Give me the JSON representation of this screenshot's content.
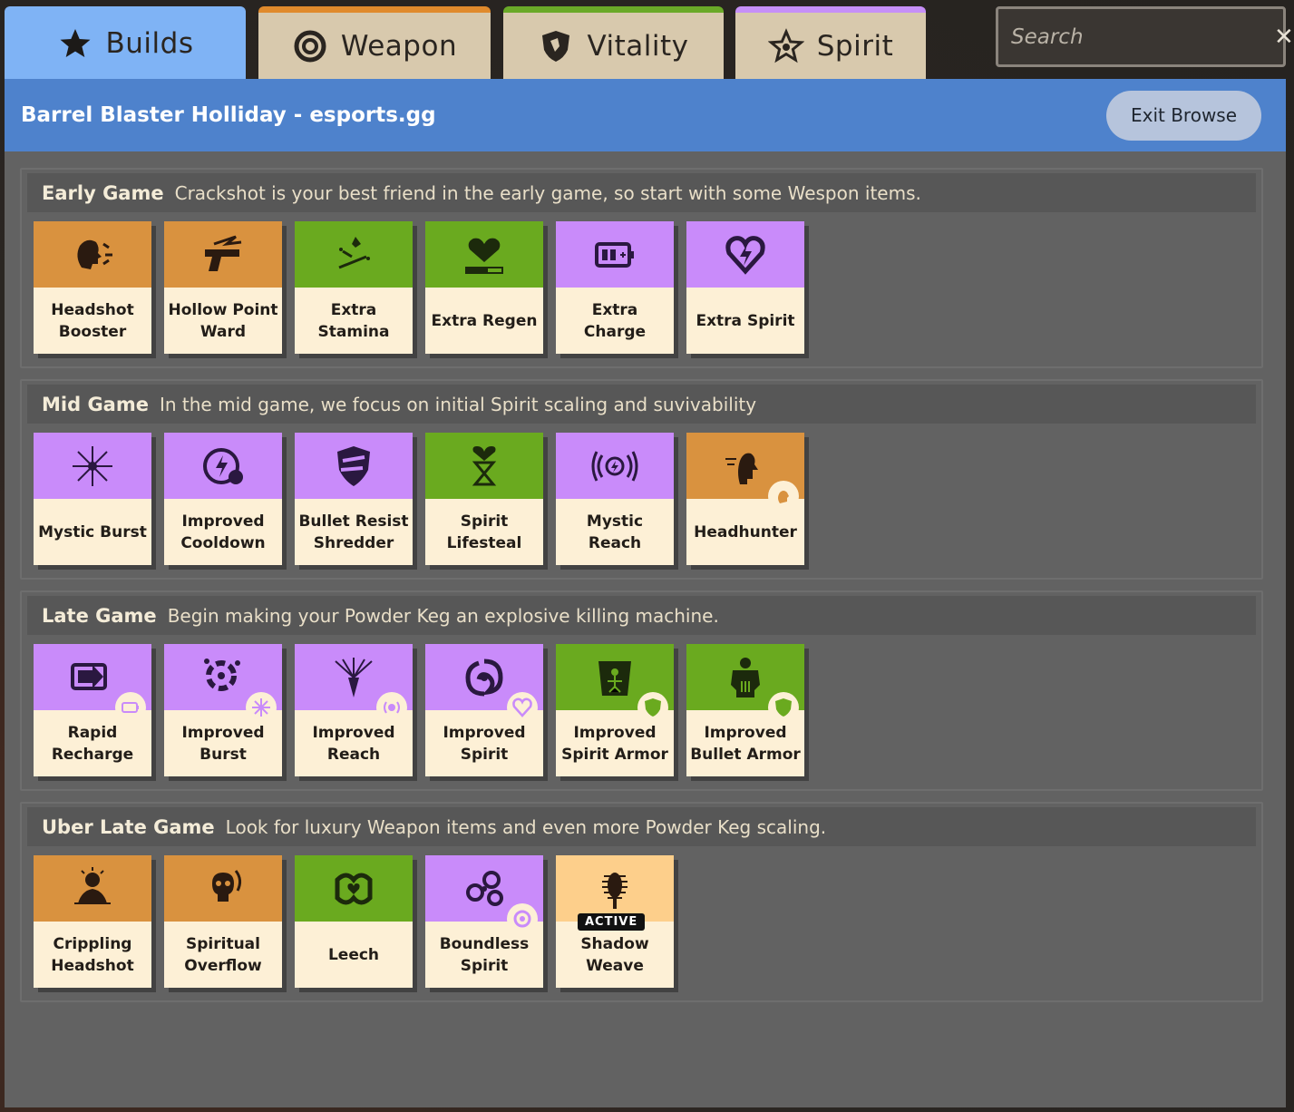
{
  "tabs": [
    {
      "label": "Builds",
      "icon": "star-icon"
    },
    {
      "label": "Weapon",
      "icon": "weapon-icon"
    },
    {
      "label": "Vitality",
      "icon": "shield-icon"
    },
    {
      "label": "Spirit",
      "icon": "spirit-star-icon"
    }
  ],
  "search": {
    "placeholder": "Search",
    "value": ""
  },
  "build": {
    "title": "Barrel Blaster Holliday - esports.gg",
    "exit_label": "Exit Browse"
  },
  "colors": {
    "weapon": "#d9923f",
    "vitality": "#6aaa1f",
    "spirit": "#c98bfa",
    "header": "#4e82cc",
    "active_tab": "#7fb3f5"
  },
  "sections": [
    {
      "name": "Early Game",
      "desc": "Crackshot is your best friend in the early game, so start with some Wespon items.",
      "items": [
        {
          "name": "Headshot Booster",
          "type": "weapon"
        },
        {
          "name": "Hollow Point Ward",
          "type": "weapon"
        },
        {
          "name": "Extra Stamina",
          "type": "vitality"
        },
        {
          "name": "Extra Regen",
          "type": "vitality"
        },
        {
          "name": "Extra Charge",
          "type": "spirit"
        },
        {
          "name": "Extra Spirit",
          "type": "spirit"
        }
      ]
    },
    {
      "name": "Mid Game",
      "desc": "In the mid game, we focus on initial Spirit scaling and suvivability",
      "items": [
        {
          "name": "Mystic Burst",
          "type": "spirit"
        },
        {
          "name": "Improved Cooldown",
          "type": "spirit"
        },
        {
          "name": "Bullet Resist Shredder",
          "type": "spirit"
        },
        {
          "name": "Spirit Lifesteal",
          "type": "vitality"
        },
        {
          "name": "Mystic Reach",
          "type": "spirit"
        },
        {
          "name": "Headhunter",
          "type": "weapon"
        }
      ]
    },
    {
      "name": "Late Game",
      "desc": "Begin making your Powder Keg an explosive killing machine.",
      "items": [
        {
          "name": "Rapid Recharge",
          "type": "spirit"
        },
        {
          "name": "Improved Burst",
          "type": "spirit"
        },
        {
          "name": "Improved Reach",
          "type": "spirit"
        },
        {
          "name": "Improved Spirit",
          "type": "spirit"
        },
        {
          "name": "Improved Spirit Armor",
          "type": "vitality"
        },
        {
          "name": "Improved Bullet Armor",
          "type": "vitality"
        }
      ]
    },
    {
      "name": "Uber Late Game",
      "desc": "Look for luxury Weapon items and even more Powder Keg scaling.",
      "items": [
        {
          "name": "Crippling Headshot",
          "type": "weapon"
        },
        {
          "name": "Spiritual Overflow",
          "type": "weapon"
        },
        {
          "name": "Leech",
          "type": "vitality"
        },
        {
          "name": "Boundless Spirit",
          "type": "spirit"
        },
        {
          "name": "Shadow Weave",
          "type": "active",
          "tag": "ACTIVE"
        }
      ]
    }
  ]
}
